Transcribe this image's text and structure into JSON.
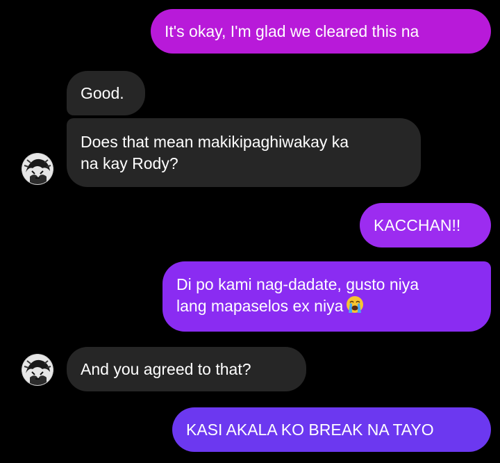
{
  "colors": {
    "background": "#000000",
    "incoming_bubble": "#262626",
    "outgoing_magenta": "#b81ad9",
    "outgoing_violet": "#8a2cf2",
    "outgoing_indigo": "#6c38f0"
  },
  "messages": [
    {
      "id": "m1",
      "direction": "outgoing",
      "text": "It's okay, I'm glad we cleared this na"
    },
    {
      "id": "m2",
      "direction": "incoming",
      "text": "Good."
    },
    {
      "id": "m3",
      "direction": "incoming",
      "lines": [
        "Does that mean makikipaghiwakay ka",
        "na kay Rody?"
      ]
    },
    {
      "id": "m4",
      "direction": "outgoing",
      "text": "KACCHAN!!"
    },
    {
      "id": "m5",
      "direction": "outgoing",
      "lines": [
        "Di po kami nag-dadate, gusto niya",
        "lang mapaselos ex niya"
      ],
      "emoji": "loudly-crying-face-icon"
    },
    {
      "id": "m6",
      "direction": "incoming",
      "text": "And you agreed to that?"
    },
    {
      "id": "m7",
      "direction": "outgoing",
      "text": "KASI AKALA KO BREAK NA TAYO"
    }
  ],
  "avatar": {
    "icon": "contact-avatar-icon"
  }
}
